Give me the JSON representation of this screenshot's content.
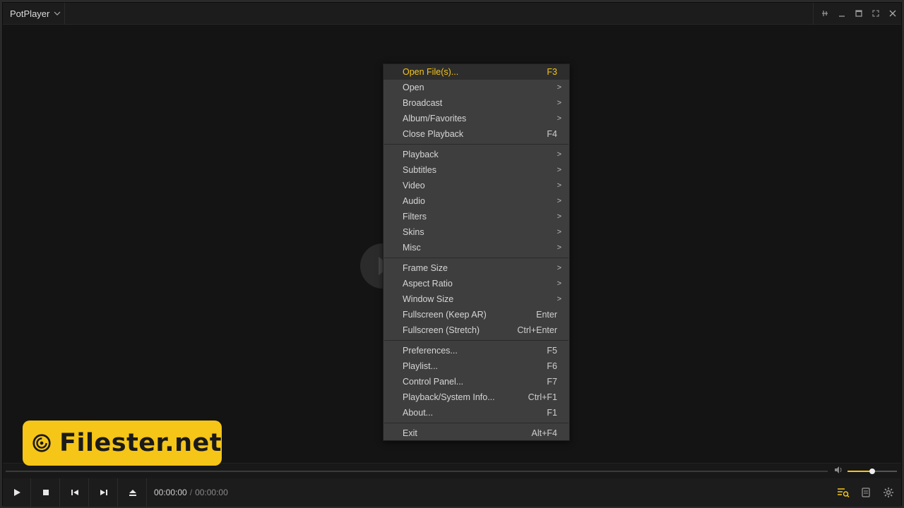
{
  "app": {
    "title": "PotPlayer"
  },
  "window_controls": [
    "pin",
    "minimize",
    "maximize",
    "fullscreen",
    "close"
  ],
  "menu": {
    "groups": [
      [
        {
          "label": "Open File(s)...",
          "shortcut": "F3",
          "highlighted": true
        },
        {
          "label": "Open",
          "submenu": true
        },
        {
          "label": "Broadcast",
          "submenu": true
        },
        {
          "label": "Album/Favorites",
          "submenu": true
        },
        {
          "label": "Close Playback",
          "shortcut": "F4"
        }
      ],
      [
        {
          "label": "Playback",
          "submenu": true
        },
        {
          "label": "Subtitles",
          "submenu": true
        },
        {
          "label": "Video",
          "submenu": true
        },
        {
          "label": "Audio",
          "submenu": true
        },
        {
          "label": "Filters",
          "submenu": true
        },
        {
          "label": "Skins",
          "submenu": true
        },
        {
          "label": "Misc",
          "submenu": true
        }
      ],
      [
        {
          "label": "Frame Size",
          "submenu": true
        },
        {
          "label": "Aspect Ratio",
          "submenu": true
        },
        {
          "label": "Window Size",
          "submenu": true
        },
        {
          "label": "Fullscreen (Keep AR)",
          "shortcut": "Enter"
        },
        {
          "label": "Fullscreen (Stretch)",
          "shortcut": "Ctrl+Enter"
        }
      ],
      [
        {
          "label": "Preferences...",
          "shortcut": "F5"
        },
        {
          "label": "Playlist...",
          "shortcut": "F6"
        },
        {
          "label": "Control Panel...",
          "shortcut": "F7"
        },
        {
          "label": "Playback/System Info...",
          "shortcut": "Ctrl+F1"
        },
        {
          "label": "About...",
          "shortcut": "F1"
        }
      ],
      [
        {
          "label": "Exit",
          "shortcut": "Alt+F4"
        }
      ]
    ],
    "submenu_arrow": ">"
  },
  "watermark": {
    "text": "Filester.net"
  },
  "playback": {
    "current_time": "00:00:00",
    "separator": "/",
    "duration": "00:00:00",
    "volume": 0.5
  },
  "colors": {
    "accent": "#f5c518",
    "menu_bg": "#3e3e3e",
    "background": "#141414"
  }
}
